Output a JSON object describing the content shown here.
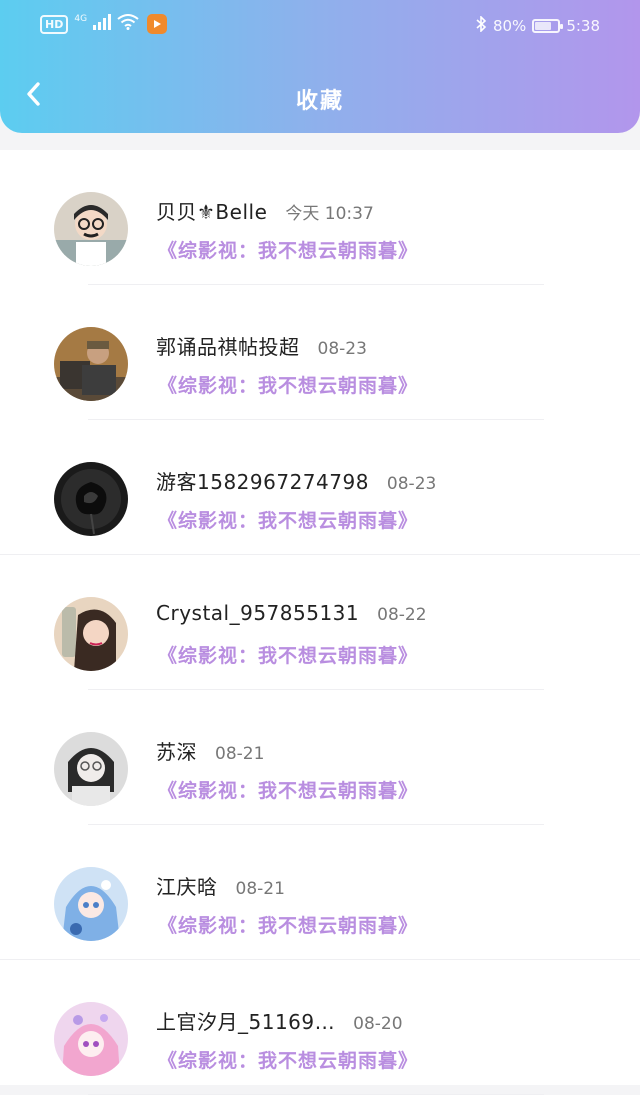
{
  "status_bar": {
    "hd": "HD",
    "network": "4G",
    "battery": "80%",
    "battery_level": 0.8,
    "time": "5:38"
  },
  "nav": {
    "title": "收藏",
    "back_icon": "chevron-left-icon"
  },
  "colors": {
    "gradient_start": "#5ccdf0",
    "gradient_end": "#b296ec",
    "link_purple": "#b98ee0"
  },
  "items": [
    {
      "name": "贝贝⚜Belle",
      "time": "今天 10:37",
      "source": "《综影视：我不想云朝雨暮》",
      "avatar": "avatar-girl-glasses"
    },
    {
      "name": "郭诵品祺帖投超",
      "time": "08-23",
      "source": "《综影视：我不想云朝雨暮》",
      "avatar": "avatar-man-car"
    },
    {
      "name": "游客1582967274798",
      "time": "08-23",
      "source": "《综影视：我不想云朝雨暮》",
      "avatar": "avatar-black-rose"
    },
    {
      "name": "Crystal_957855131",
      "time": "08-22",
      "source": "《综影视：我不想云朝雨暮》",
      "avatar": "avatar-girl-selfie"
    },
    {
      "name": "苏深",
      "time": "08-21",
      "source": "《综影视：我不想云朝雨暮》",
      "avatar": "avatar-girl-bw"
    },
    {
      "name": "江庆晗",
      "time": "08-21",
      "source": "《综影视：我不想云朝雨暮》",
      "avatar": "avatar-anime-blue"
    },
    {
      "name": "上官汐月_51169…",
      "time": "08-20",
      "source": "《综影视：我不想云朝雨暮》",
      "avatar": "avatar-anime-pink"
    }
  ]
}
